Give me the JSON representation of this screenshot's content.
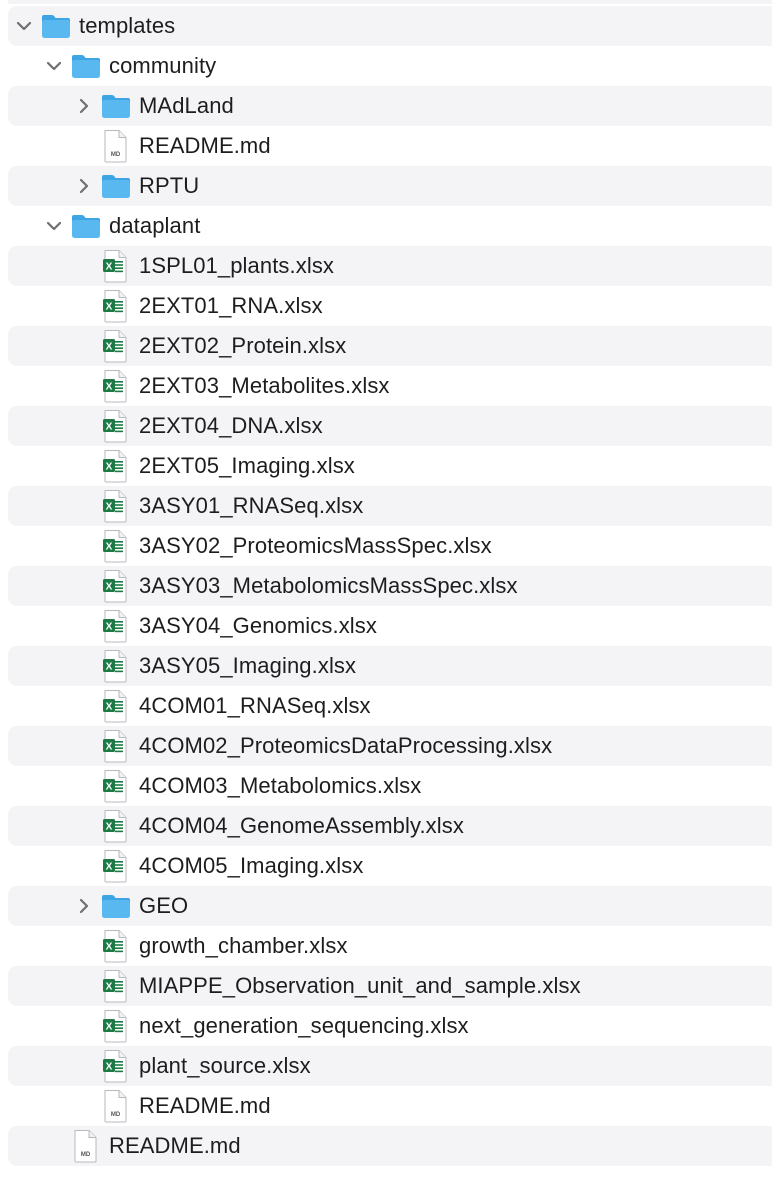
{
  "tree": [
    {
      "label": "templates",
      "type": "folder",
      "expanded": true,
      "depth": 0
    },
    {
      "label": "community",
      "type": "folder",
      "expanded": true,
      "depth": 1
    },
    {
      "label": "MAdLand",
      "type": "folder",
      "expanded": false,
      "depth": 2
    },
    {
      "label": "README.md",
      "type": "md",
      "depth": 2
    },
    {
      "label": "RPTU",
      "type": "folder",
      "expanded": false,
      "depth": 2
    },
    {
      "label": "dataplant",
      "type": "folder",
      "expanded": true,
      "depth": 1
    },
    {
      "label": "1SPL01_plants.xlsx",
      "type": "xlsx",
      "depth": 2
    },
    {
      "label": "2EXT01_RNA.xlsx",
      "type": "xlsx",
      "depth": 2
    },
    {
      "label": "2EXT02_Protein.xlsx",
      "type": "xlsx",
      "depth": 2
    },
    {
      "label": "2EXT03_Metabolites.xlsx",
      "type": "xlsx",
      "depth": 2
    },
    {
      "label": "2EXT04_DNA.xlsx",
      "type": "xlsx",
      "depth": 2
    },
    {
      "label": "2EXT05_Imaging.xlsx",
      "type": "xlsx",
      "depth": 2
    },
    {
      "label": "3ASY01_RNASeq.xlsx",
      "type": "xlsx",
      "depth": 2
    },
    {
      "label": "3ASY02_ProteomicsMassSpec.xlsx",
      "type": "xlsx",
      "depth": 2
    },
    {
      "label": "3ASY03_MetabolomicsMassSpec.xlsx",
      "type": "xlsx",
      "depth": 2
    },
    {
      "label": "3ASY04_Genomics.xlsx",
      "type": "xlsx",
      "depth": 2
    },
    {
      "label": "3ASY05_Imaging.xlsx",
      "type": "xlsx",
      "depth": 2
    },
    {
      "label": "4COM01_RNASeq.xlsx",
      "type": "xlsx",
      "depth": 2
    },
    {
      "label": "4COM02_ProteomicsDataProcessing.xlsx",
      "type": "xlsx",
      "depth": 2
    },
    {
      "label": "4COM03_Metabolomics.xlsx",
      "type": "xlsx",
      "depth": 2
    },
    {
      "label": "4COM04_GenomeAssembly.xlsx",
      "type": "xlsx",
      "depth": 2
    },
    {
      "label": "4COM05_Imaging.xlsx",
      "type": "xlsx",
      "depth": 2
    },
    {
      "label": "GEO",
      "type": "folder",
      "expanded": false,
      "depth": 2
    },
    {
      "label": "growth_chamber.xlsx",
      "type": "xlsx",
      "depth": 2
    },
    {
      "label": "MIAPPE_Observation_unit_and_sample.xlsx",
      "type": "xlsx",
      "depth": 2
    },
    {
      "label": "next_generation_sequencing.xlsx",
      "type": "xlsx",
      "depth": 2
    },
    {
      "label": "plant_source.xlsx",
      "type": "xlsx",
      "depth": 2
    },
    {
      "label": "README.md",
      "type": "md",
      "depth": 2
    },
    {
      "label": "README.md",
      "type": "md",
      "depth": 1
    }
  ],
  "colors": {
    "folder": "#5ab8f0",
    "folder_tab": "#3ea4e3",
    "excel": "#1d7a45",
    "stripe": "#f4f4f6",
    "chevron": "#6e6e73"
  },
  "icon_captions": {
    "md": "MD",
    "excel_mark": "X"
  }
}
